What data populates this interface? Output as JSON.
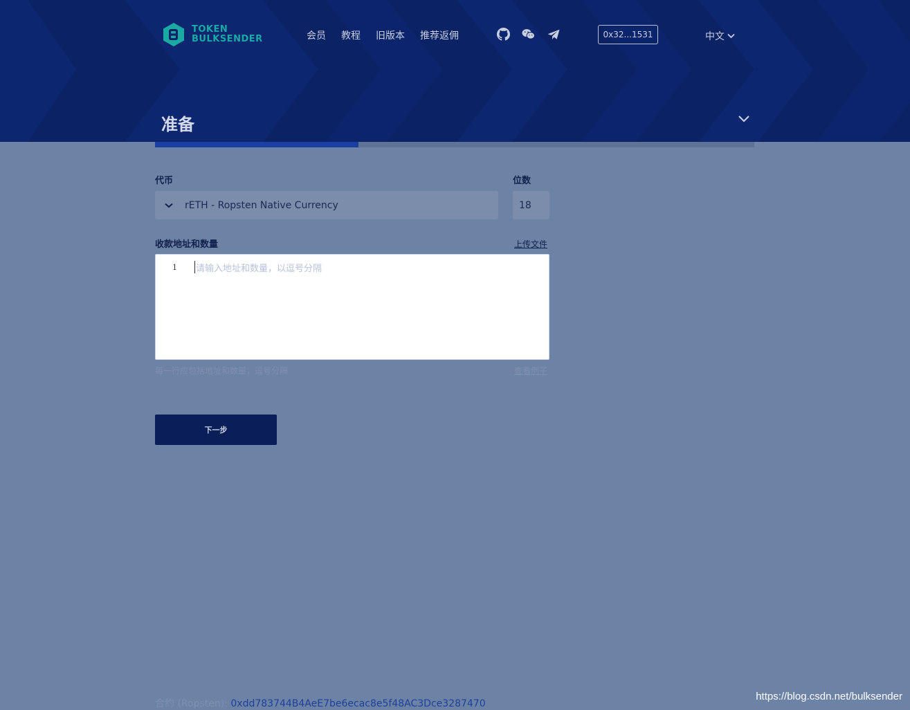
{
  "colors": {
    "header_bg": "#0b2265",
    "body_bg": "#6d83a5",
    "logo_teal": "#1aa9a3",
    "progress_fill": "#1b3ea2",
    "button_bg": "#0a1f5a",
    "contract_link": "#1f3f9c"
  },
  "header": {
    "logo": {
      "line1": "TOKEN",
      "line2": "BULKSENDER"
    },
    "nav": [
      {
        "label": "会员"
      },
      {
        "label": "教程"
      },
      {
        "label": "旧版本"
      },
      {
        "label": "推荐返佣"
      }
    ],
    "social_icons": [
      "github-icon",
      "wechat-icon",
      "telegram-icon"
    ],
    "wallet_address": "0x32...1531",
    "language": "中文"
  },
  "step": {
    "title": "准备",
    "progress": 0.34
  },
  "form": {
    "token_label": "代币",
    "token_value": "rETH - Ropsten Native Currency",
    "decimals_label": "位数",
    "decimals_value": "18",
    "addresses_label": "收款地址和数量",
    "upload_link": "上传文件",
    "editor_line_number": "1",
    "editor_placeholder": "请输入地址和数量，以逗号分隔",
    "hint": "每一行应包括地址和数量，逗号分隔",
    "example_link": "查看例子",
    "next_button": "下一步"
  },
  "footer": {
    "contract_label": "合约 (Ropsten):",
    "contract_address": "0xdd783744B4AeE7be6ecac8e5f48AC3Dce3287470"
  },
  "watermark": "https://blog.csdn.net/bulksender"
}
